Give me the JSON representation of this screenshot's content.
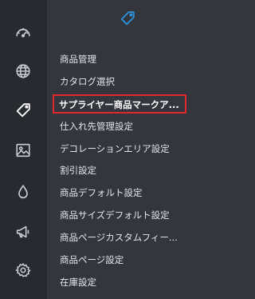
{
  "rail": {
    "icons": [
      "dashboard-gauge-icon",
      "globe-icon",
      "tag-icon",
      "image-icon",
      "drop-icon",
      "megaphone-icon",
      "settings-gear-icon"
    ],
    "active_icon": "tag-icon"
  },
  "panel": {
    "header_icon": "tag-icon",
    "accent_color": "#2f8fd8",
    "items": [
      {
        "label": "商品管理"
      },
      {
        "label": "カタログ選択"
      },
      {
        "label": "サプライヤー商品マークア..."
      },
      {
        "label": "仕入れ先管理設定"
      },
      {
        "label": "デコレーションエリア設定"
      },
      {
        "label": "割引設定"
      },
      {
        "label": "商品デフォルト設定"
      },
      {
        "label": "商品サイズデフォルト設定"
      },
      {
        "label": "商品ページカスタムフィー..."
      },
      {
        "label": "商品ページ設定"
      },
      {
        "label": "在庫設定"
      }
    ],
    "active_index": 2,
    "highlight_color": "#e0292f"
  }
}
